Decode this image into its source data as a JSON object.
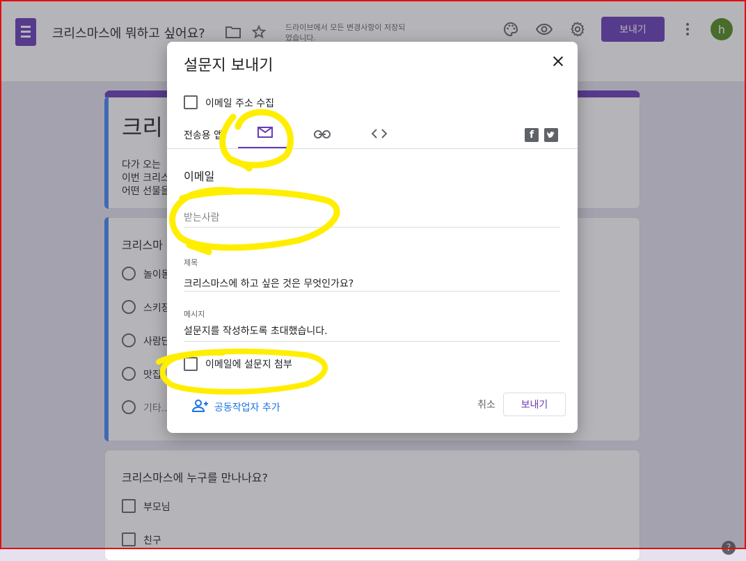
{
  "header": {
    "doc_title": "크리스마스에 뭐하고 싶어요?",
    "save_status": "드라이브에서 모든 변경사항이 저장되었습니다.",
    "send_label": "보내기",
    "avatar_letter": "h",
    "icons": [
      "forms-logo-icon",
      "folder-icon",
      "star-icon",
      "palette-icon",
      "eye-icon",
      "gear-icon",
      "more-vert-icon"
    ]
  },
  "form": {
    "title": "크리",
    "description_lines": [
      "다가 오는",
      "이번 크리스",
      "어떤 선물을"
    ],
    "question1": {
      "title": "크리스마",
      "options": [
        "놀이동",
        "스키장",
        "사람단",
        "맛집",
        "기타..."
      ]
    },
    "question2": {
      "title": "크리스마스에 누구를 만나나요?",
      "options": [
        "부모님",
        "친구"
      ]
    }
  },
  "dialog": {
    "title": "설문지 보내기",
    "collect_email_label": "이메일 주소 수집",
    "send_via_label": "전송용 앱:",
    "tabs": [
      "email-icon",
      "link-icon",
      "embed-code-icon"
    ],
    "section_heading": "이메일",
    "to_placeholder": "받는사람",
    "subject_label": "제목",
    "subject_value": "크리스마스에 하고 싶은 것은 무엇인가요?",
    "message_label": "메시지",
    "message_value": "설문지를 작성하도록 초대했습니다.",
    "include_form_label": "이메일에 설문지 첨부",
    "add_collaborators_label": "공동작업자 추가",
    "cancel_label": "취소",
    "send_label": "보내기"
  },
  "colors": {
    "accent": "#673ab7",
    "highlight": "#ffee00",
    "border_red": "#e01010"
  }
}
